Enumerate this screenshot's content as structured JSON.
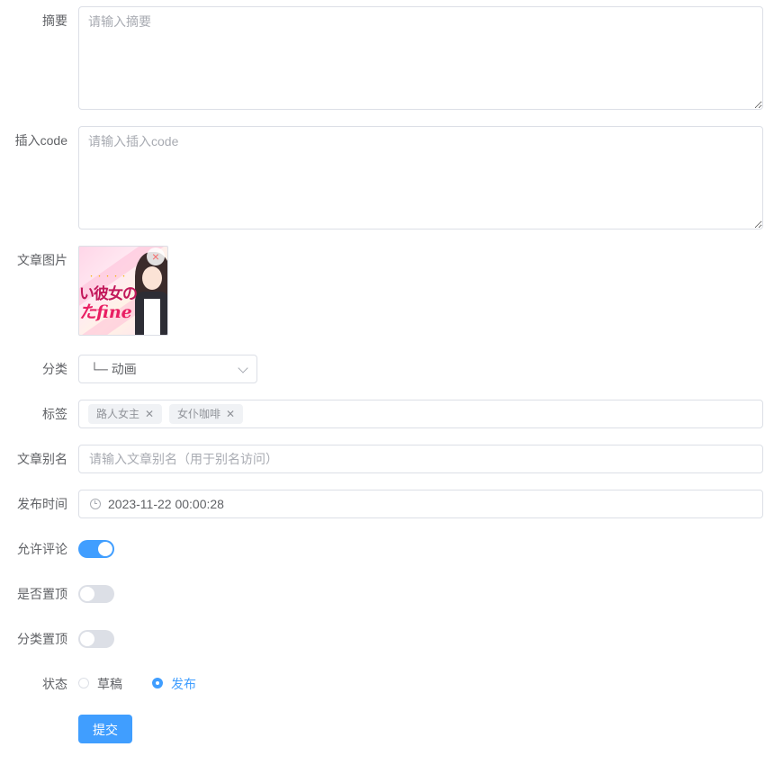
{
  "form": {
    "summary": {
      "label": "摘要",
      "placeholder": "请输入摘要",
      "value": ""
    },
    "code": {
      "label": "插入code",
      "placeholder": "请输入插入code",
      "value": ""
    },
    "image": {
      "label": "文章图片",
      "remove_icon": "close-icon",
      "logo_line1": "い彼女の",
      "logo_line2": "たfine",
      "logo_small": "・・・・・"
    },
    "category": {
      "label": "分类",
      "value": "└─ 动画",
      "icon": "chevron-down-icon"
    },
    "tags": {
      "label": "标签",
      "items": [
        {
          "text": "路人女主"
        },
        {
          "text": "女仆咖啡"
        }
      ],
      "remove_icon": "close-icon"
    },
    "alias": {
      "label": "文章别名",
      "placeholder": "请输入文章别名（用于别名访问）",
      "value": ""
    },
    "publish_time": {
      "label": "发布时间",
      "value": "2023-11-22 00:00:28",
      "icon": "clock-icon"
    },
    "allow_comment": {
      "label": "允许评论",
      "on": true
    },
    "pin_top": {
      "label": "是否置顶",
      "on": false
    },
    "category_pin": {
      "label": "分类置顶",
      "on": false
    },
    "status": {
      "label": "状态",
      "options": [
        {
          "label": "草稿",
          "checked": false
        },
        {
          "label": "发布",
          "checked": true
        }
      ]
    },
    "submit_label": "提交"
  },
  "colors": {
    "primary": "#409eff",
    "border": "#dcdfe6",
    "text": "#606266",
    "placeholder": "#a8abb2",
    "danger": "#f56c6c"
  }
}
